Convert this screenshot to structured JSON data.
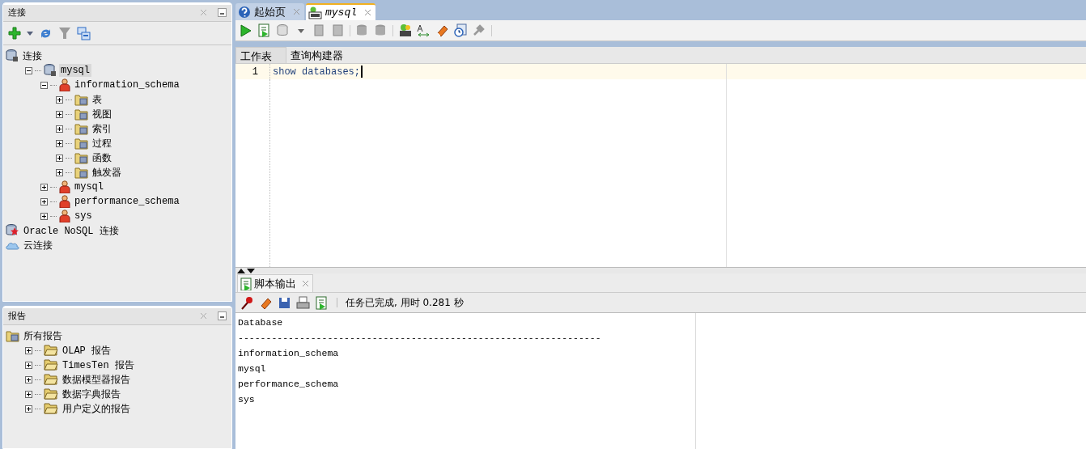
{
  "connections": {
    "title": "连接",
    "tree": [
      {
        "label": "连接",
        "kind": "root",
        "children": [
          {
            "label": "mysql",
            "kind": "connection",
            "expanded": true,
            "selected": true,
            "children": [
              {
                "label": "information_schema",
                "kind": "schema",
                "expanded": true,
                "selected": false,
                "children": [
                  {
                    "label": "表",
                    "kind": "folder",
                    "expanded": false,
                    "selected": false
                  },
                  {
                    "label": "视图",
                    "kind": "folder",
                    "expanded": false,
                    "selected": false
                  },
                  {
                    "label": "索引",
                    "kind": "folder",
                    "expanded": false,
                    "selected": false
                  },
                  {
                    "label": "过程",
                    "kind": "folder",
                    "expanded": false,
                    "selected": false
                  },
                  {
                    "label": "函数",
                    "kind": "folder",
                    "expanded": false,
                    "selected": false
                  },
                  {
                    "label": "触发器",
                    "kind": "folder",
                    "expanded": false,
                    "selected": false
                  }
                ]
              },
              {
                "label": "mysql",
                "kind": "schema",
                "expanded": false,
                "selected": false
              },
              {
                "label": "performance_schema",
                "kind": "schema",
                "expanded": false,
                "selected": false
              },
              {
                "label": "sys",
                "kind": "schema",
                "expanded": false,
                "selected": false
              }
            ]
          }
        ]
      },
      {
        "label": "Oracle NoSQL 连接",
        "kind": "nosql"
      },
      {
        "label": "云连接",
        "kind": "cloud"
      }
    ]
  },
  "reports": {
    "title": "报告",
    "tree": [
      {
        "label": "所有报告",
        "kind": "reportroot",
        "children": [
          {
            "label": "OLAP 报告",
            "kind": "report",
            "expanded": false,
            "selected": false
          },
          {
            "label": "TimesTen 报告",
            "kind": "report",
            "expanded": false,
            "selected": false
          },
          {
            "label": "数据模型器报告",
            "kind": "report",
            "expanded": false,
            "selected": false
          },
          {
            "label": "数据字典报告",
            "kind": "report",
            "expanded": false,
            "selected": false
          },
          {
            "label": "用户定义的报告",
            "kind": "report",
            "expanded": false,
            "selected": false
          }
        ]
      }
    ]
  },
  "editor_tabs": [
    {
      "label": "起始页",
      "kind": "start",
      "selected": false
    },
    {
      "label": "mysql",
      "kind": "sql",
      "selected": true
    }
  ],
  "worksheet_tabs": [
    {
      "label": "工作表",
      "selected": true
    },
    {
      "label": "查询构建器",
      "selected": false
    }
  ],
  "editor_lines": [
    {
      "number": "1",
      "code": "show databases;"
    }
  ],
  "output": {
    "tab": "脚本输出",
    "status": "任务已完成, 用时 0.281 秒",
    "lines": [
      "Database",
      "-----------------------------------------------------------------",
      "information_schema",
      "mysql",
      "performance_schema",
      "sys"
    ]
  }
}
